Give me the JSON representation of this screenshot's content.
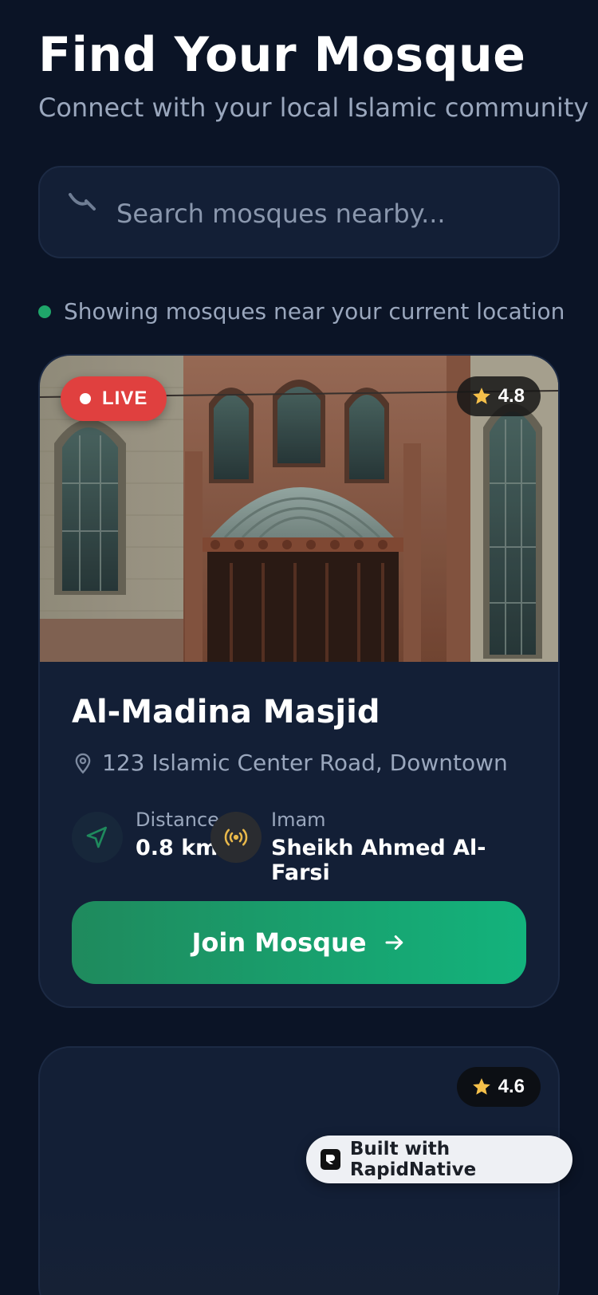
{
  "header": {
    "title": "Find Your Mosque",
    "subtitle": "Connect with your local Islamic community"
  },
  "search": {
    "placeholder": "Search mosques nearby...",
    "icon": "search-icon"
  },
  "location_status": {
    "text": "Showing mosques near your current location",
    "dot_color": "#1fa66a"
  },
  "mosques": [
    {
      "live_label": "LIVE",
      "rating": "4.8",
      "name": "Al-Madina Masjid",
      "address": "123 Islamic Center Road, Downtown",
      "distance_label": "Distance",
      "distance_value": "0.8 km",
      "imam_label": "Imam",
      "imam_value": "Sheikh Ahmed Al-Farsi",
      "join_label": "Join Mosque"
    },
    {
      "rating": "4.6"
    }
  ],
  "badge": {
    "text": "Built with RapidNative"
  },
  "colors": {
    "background": "#0b1426",
    "card": "#131f36",
    "accent_green": "#13b37c",
    "live_red": "#e0403f",
    "star_yellow": "#f5c04a"
  }
}
